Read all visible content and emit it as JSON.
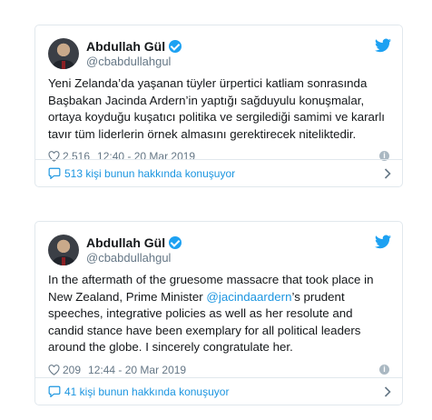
{
  "tweets": [
    {
      "display_name": "Abdullah Gül",
      "handle": "@cbabdullahgul",
      "text_before": "Yeni Zelanda’da yaşanan tüyler ürpertici katliam sonrasında Başbakan Jacinda Ardern’in yaptığı sağduyulu konuşmalar, ortaya koyduğu kuşatıcı politika ve sergilediği samimi ve kararlı tavır tüm liderlerin örnek almasını gerektirecek niteliktedir.",
      "mention": "",
      "text_after": "",
      "likes": "2.516",
      "timestamp": "12:40 - 20 Mar 2019",
      "footer": "513 kişi bunun hakkında konuşuyor"
    },
    {
      "display_name": "Abdullah Gül",
      "handle": "@cbabdullahgul",
      "text_before": "In the aftermath of the gruesome massacre that took place in New Zealand, Prime Minister ",
      "mention": "@jacindaardern",
      "text_after": "’s prudent speeches, integrative policies as well as her resolute and candid stance have been exemplary for all political leaders around the globe. I sincerely congratulate her.",
      "likes": "209",
      "timestamp": "12:44 - 20 Mar 2019",
      "footer": "41 kişi bunun hakkında konuşuyor"
    }
  ],
  "icons": {
    "verified": "verified-badge-icon",
    "bird": "twitter-bird-icon",
    "heart": "heart-icon",
    "info": "info-icon",
    "bubble": "speech-bubble-icon",
    "chevron": "chevron-right-icon"
  },
  "colors": {
    "twitter_blue": "#1da1f2",
    "link_blue": "#1b95e0",
    "muted": "#657786",
    "border": "#e1e8ed"
  }
}
